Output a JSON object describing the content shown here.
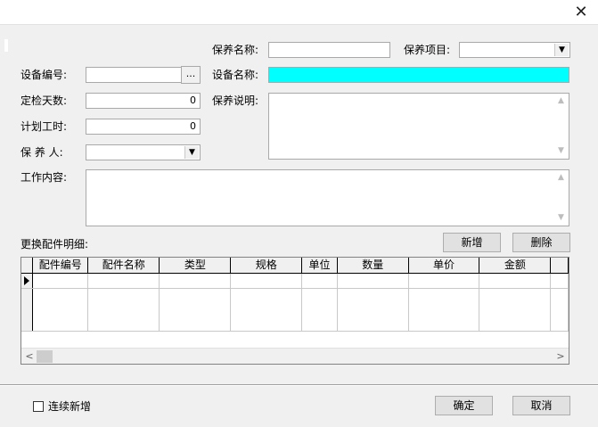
{
  "window": {
    "close_glyph": "✕"
  },
  "form": {
    "maint_name_label": "保养名称:",
    "maint_name_value": "",
    "maint_item_label": "保养项目:",
    "maint_item_value": "",
    "device_code_label": "设备编号:",
    "device_code_value": "",
    "device_code_btn": "...",
    "device_name_label": "设备名称:",
    "device_name_value": "",
    "device_name_bg": "#00ffff",
    "check_days_label": "定检天数:",
    "check_days_value": "0",
    "maint_desc_label": "保养说明:",
    "plan_hours_label": "计划工时:",
    "plan_hours_value": "0",
    "maintainer_label": "保 养 人:",
    "maintainer_value": "",
    "work_content_label": "工作内容:"
  },
  "parts": {
    "section_label": "更换配件明细:",
    "add_button": "新增",
    "delete_button": "删除",
    "columns": [
      "配件编号",
      "配件名称",
      "类型",
      "规格",
      "单位",
      "数量",
      "单价",
      "金额"
    ]
  },
  "footer": {
    "continue_add_label": "连续新增",
    "ok_button": "确定",
    "cancel_button": "取消"
  }
}
